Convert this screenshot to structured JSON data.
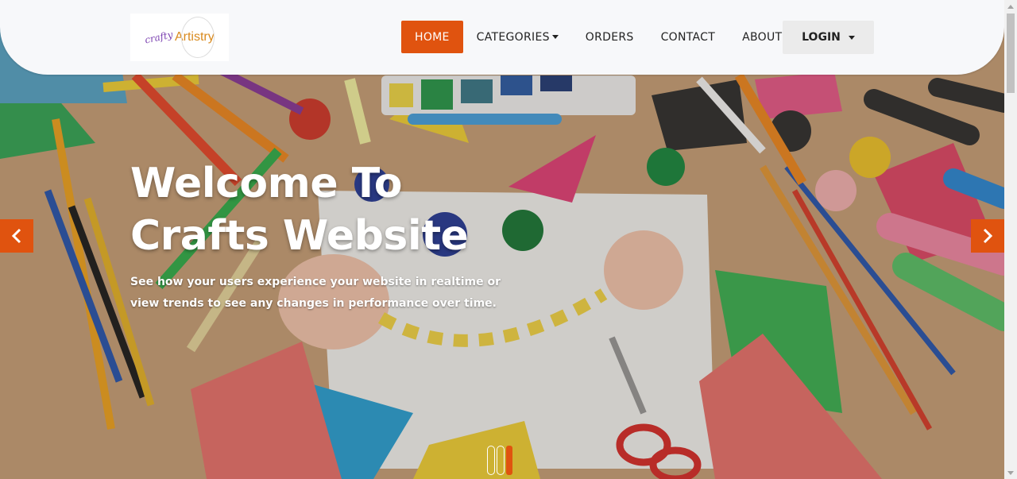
{
  "brand": {
    "logo_script": "crafty",
    "logo_text": "Artistry"
  },
  "nav": {
    "items": [
      {
        "label": "HOME",
        "active": true
      },
      {
        "label": "CATEGORIES",
        "dropdown": true
      },
      {
        "label": "ORDERS"
      },
      {
        "label": "CONTACT"
      },
      {
        "label": "ABOUT"
      }
    ],
    "login_label": "LOGIN"
  },
  "hero": {
    "title_line1": "Welcome To",
    "title_line2": "Crafts Website",
    "subtitle": "See how your users experience your website in realtime or view trends to see any changes in performance over time."
  },
  "carousel": {
    "prev_icon": "chevron-left-icon",
    "next_icon": "chevron-right-icon",
    "slide_count": 3,
    "active_slide": 3
  },
  "colors": {
    "accent": "#e0530f",
    "header_bg": "#f7f8fa",
    "login_bg": "#ebebeb"
  }
}
